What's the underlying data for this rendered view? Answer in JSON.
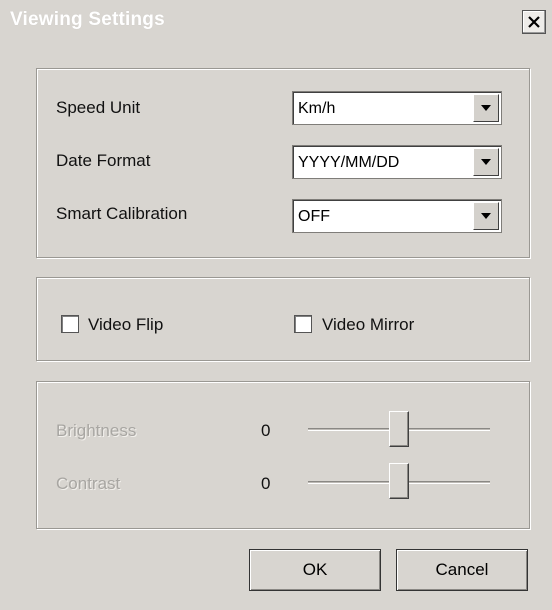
{
  "window": {
    "title": "Viewing Settings",
    "close_icon": "close-icon"
  },
  "display": {
    "speed_unit": {
      "label": "Speed Unit",
      "value": "Km/h"
    },
    "date_format": {
      "label": "Date Format",
      "value": "YYYY/MM/DD"
    },
    "smart_calibration": {
      "label": "Smart Calibration",
      "value": "OFF"
    }
  },
  "video": {
    "flip": {
      "label": "Video Flip",
      "checked": false
    },
    "mirror": {
      "label": "Video Mirror",
      "checked": false
    }
  },
  "image": {
    "brightness": {
      "label": "Brightness",
      "value": "0",
      "level": 0.5,
      "enabled": false
    },
    "contrast": {
      "label": "Contrast",
      "value": "0",
      "level": 0.5,
      "enabled": false
    }
  },
  "buttons": {
    "ok": "OK",
    "cancel": "Cancel"
  }
}
